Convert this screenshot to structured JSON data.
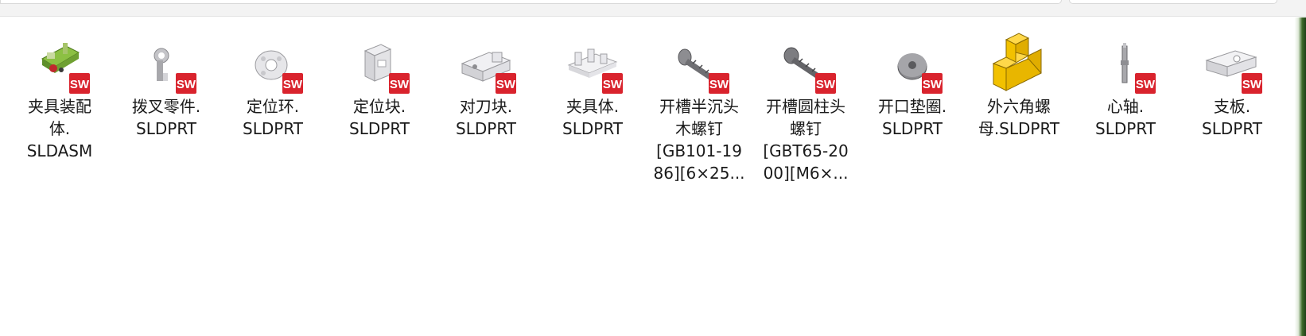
{
  "files": [
    {
      "name": "夹具装配体.SLDASM",
      "line1": "夹具装配",
      "line2": "体.",
      "line3": "SLDASM",
      "line4": "",
      "icon": "assembly-icon"
    },
    {
      "name": "拨叉零件.SLDPRT",
      "line1": "拨叉零件.",
      "line2": "SLDPRT",
      "line3": "",
      "line4": "",
      "icon": "fork-part-icon"
    },
    {
      "name": "定位环.SLDPRT",
      "line1": "定位环.",
      "line2": "SLDPRT",
      "line3": "",
      "line4": "",
      "icon": "ring-part-icon"
    },
    {
      "name": "定位块.SLDPRT",
      "line1": "定位块.",
      "line2": "SLDPRT",
      "line3": "",
      "line4": "",
      "icon": "block-part-icon"
    },
    {
      "name": "对刀块.SLDPRT",
      "line1": "对刀块.",
      "line2": "SLDPRT",
      "line3": "",
      "line4": "",
      "icon": "setting-block-part-icon"
    },
    {
      "name": "夹具体.SLDPRT",
      "line1": "夹具体.",
      "line2": "SLDPRT",
      "line3": "",
      "line4": "",
      "icon": "fixture-body-part-icon"
    },
    {
      "name": "开槽半沉头木螺钉[GB101-1986][6×25...",
      "line1": "开槽半沉头",
      "line2": "木螺钉",
      "line3": "[GB101-19",
      "line4": "86][6×25...",
      "icon": "screw-part-icon"
    },
    {
      "name": "开槽圆柱头螺钉[GBT65-2000][M6×...",
      "line1": "开槽圆柱头",
      "line2": "螺钉",
      "line3": "[GBT65-20",
      "line4": "00][M6×...",
      "icon": "cap-screw-part-icon"
    },
    {
      "name": "开口垫圈.SLDPRT",
      "line1": "开口垫圈.",
      "line2": "SLDPRT",
      "line3": "",
      "line4": "",
      "icon": "washer-part-icon"
    },
    {
      "name": "外六角螺母.SLDPRT",
      "line1": "外六角螺",
      "line2": "母.SLDPRT",
      "line3": "",
      "line4": "",
      "icon": "generic-part-icon"
    },
    {
      "name": "心轴.SLDPRT",
      "line1": "心轴.",
      "line2": "SLDPRT",
      "line3": "",
      "line4": "",
      "icon": "shaft-part-icon"
    },
    {
      "name": "支板.SLDPRT",
      "line1": "支板.",
      "line2": "SLDPRT",
      "line3": "",
      "line4": "",
      "icon": "plate-part-icon"
    }
  ],
  "badge_text": "SW",
  "colors": {
    "badge_red": "#d9232d",
    "part_grey": "#b9b9bd",
    "generic_yellow": "#f2c100",
    "assembly_green": "#7fb034"
  }
}
